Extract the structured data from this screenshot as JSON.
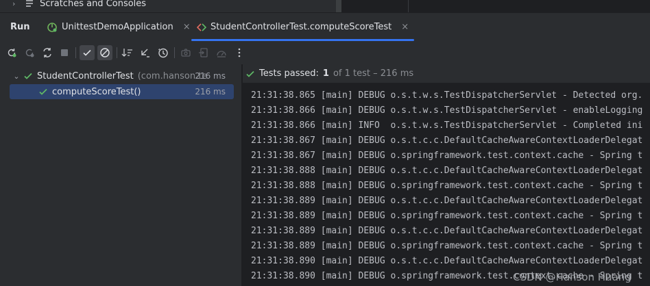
{
  "project_tree": {
    "item_label": "Scratches and Consoles"
  },
  "run_panel": {
    "title": "Run",
    "tabs": [
      {
        "label": "UnittestDemoApplication",
        "close": "×"
      },
      {
        "label": "StudentControllerTest.computeScoreTest",
        "close": "×"
      }
    ]
  },
  "test_tree": {
    "root": {
      "label": "StudentControllerTest",
      "package": "(com.hanson.te",
      "duration": "216 ms"
    },
    "child": {
      "label": "computeScoreTest()",
      "duration": "216 ms"
    }
  },
  "status": {
    "prefix": "Tests passed:",
    "count": "1",
    "suffix": "of 1 test – 216 ms"
  },
  "console": {
    "lines": [
      "21:31:38.865 [main] DEBUG o.s.t.w.s.TestDispatcherServlet - Detected org.",
      "21:31:38.866 [main] DEBUG o.s.t.w.s.TestDispatcherServlet - enableLogging",
      "21:31:38.866 [main] INFO  o.s.t.w.s.TestDispatcherServlet - Completed ini",
      "21:31:38.867 [main] DEBUG o.s.t.c.c.DefaultCacheAwareContextLoaderDelegat",
      "21:31:38.867 [main] DEBUG o.springframework.test.context.cache - Spring t",
      "21:31:38.888 [main] DEBUG o.s.t.c.c.DefaultCacheAwareContextLoaderDelegat",
      "21:31:38.888 [main] DEBUG o.springframework.test.context.cache - Spring t",
      "21:31:38.889 [main] DEBUG o.s.t.c.c.DefaultCacheAwareContextLoaderDelegat",
      "21:31:38.889 [main] DEBUG o.springframework.test.context.cache - Spring t",
      "21:31:38.889 [main] DEBUG o.s.t.c.c.DefaultCacheAwareContextLoaderDelegat",
      "21:31:38.889 [main] DEBUG o.springframework.test.context.cache - Spring t",
      "21:31:38.890 [main] DEBUG o.s.t.c.c.DefaultCacheAwareContextLoaderDelegat",
      "21:31:38.890 [main] DEBUG o.springframework.test.context.cache - Spring t"
    ]
  },
  "watermark": "CSDN @Hanson Huang",
  "colors": {
    "pass_green": "#5fb865",
    "accent_blue": "#3574f0",
    "selection": "#2e436e",
    "background": "#2b2d30",
    "console_bg": "#1e1f22"
  }
}
